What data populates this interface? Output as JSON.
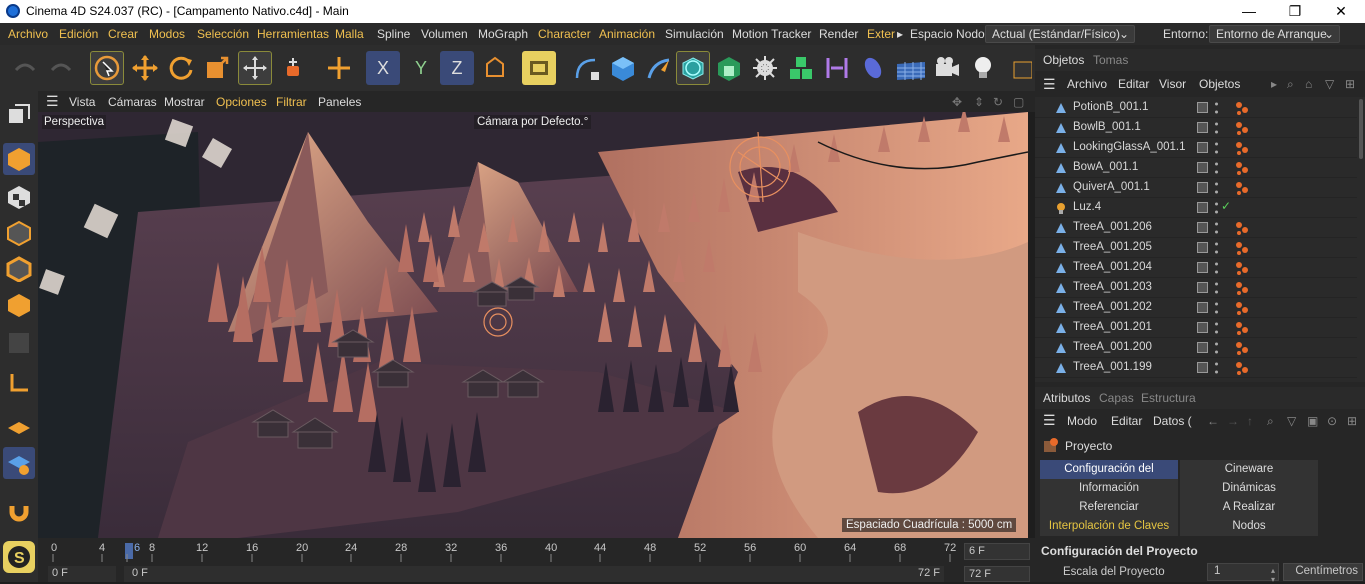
{
  "window": {
    "title": "Cinema 4D S24.037 (RC) - [Campamento Nativo.c4d] - Main",
    "controls": [
      "—",
      "❐",
      "✕"
    ]
  },
  "menubar": {
    "items": [
      "Archivo",
      "Edición",
      "Crear",
      "Modos",
      "Selección",
      "Herramientas",
      "Malla",
      "Spline",
      "Volumen",
      "MoGraph",
      "Character",
      "Animación",
      "Simulación",
      "Motion Tracker",
      "Render",
      "Exter"
    ],
    "node_space_label": "Espacio Nodo:",
    "node_space_value": "Actual (Estándar/Físico)",
    "env_label": "Entorno:",
    "env_value": "Entorno de Arranque"
  },
  "viewport": {
    "menu": [
      "Vista",
      "Cámaras",
      "Mostrar",
      "Opciones",
      "Filtrar",
      "Paneles"
    ],
    "view_name": "Perspectiva",
    "camera_name": "Cámara por Defecto",
    "camera_mark": ".°",
    "grid_spacing": "Espaciado Cuadrícula : 5000 cm"
  },
  "objects_panel": {
    "tabs": [
      "Objetos",
      "Tomas"
    ],
    "menu": [
      "Archivo",
      "Editar",
      "Visor",
      "Objetos"
    ],
    "rows": [
      {
        "name": "PotionB_001.1",
        "type": "mesh"
      },
      {
        "name": "BowlB_001.1",
        "type": "mesh"
      },
      {
        "name": "LookingGlassA_001.1",
        "type": "mesh"
      },
      {
        "name": "BowA_001.1",
        "type": "mesh"
      },
      {
        "name": "QuiverA_001.1",
        "type": "mesh"
      },
      {
        "name": "Luz.4",
        "type": "light"
      },
      {
        "name": "TreeA_001.206",
        "type": "mesh"
      },
      {
        "name": "TreeA_001.205",
        "type": "mesh"
      },
      {
        "name": "TreeA_001.204",
        "type": "mesh"
      },
      {
        "name": "TreeA_001.203",
        "type": "mesh"
      },
      {
        "name": "TreeA_001.202",
        "type": "mesh"
      },
      {
        "name": "TreeA_001.201",
        "type": "mesh"
      },
      {
        "name": "TreeA_001.200",
        "type": "mesh"
      },
      {
        "name": "TreeA_001.199",
        "type": "mesh"
      }
    ]
  },
  "attributes_panel": {
    "tabs": [
      "Atributos",
      "Capas",
      "Estructura"
    ],
    "menu": [
      "Modo",
      "Editar",
      "Datos ("
    ],
    "object_label": "Proyecto",
    "cells": [
      {
        "label": "Configuración del Proyecto",
        "state": "active"
      },
      {
        "label": "Cineware",
        "state": "normal"
      },
      {
        "label": "Información",
        "state": "normal"
      },
      {
        "label": "Dinámicas",
        "state": "normal"
      },
      {
        "label": "Referenciar",
        "state": "normal"
      },
      {
        "label": "A Realizar",
        "state": "normal"
      },
      {
        "label": "Interpolación de Claves",
        "state": "highlight"
      },
      {
        "label": "Nodos",
        "state": "normal"
      }
    ],
    "section_title": "Configuración del Proyecto",
    "scale_label": "Escala del Proyecto",
    "scale_value": "1",
    "scale_unit": "Centímetros"
  },
  "timeline": {
    "ticks": [
      "0",
      "4",
      "6",
      "8",
      "12",
      "16",
      "20",
      "24",
      "28",
      "32",
      "36",
      "40",
      "44",
      "48",
      "52",
      "56",
      "60",
      "64",
      "68",
      "72"
    ],
    "current_frame": "6 F",
    "start_field": "0 F",
    "start_field2": "0 F",
    "end_field": "72 F",
    "end_field2": "72 F"
  },
  "colors": {
    "accent_yellow": "#e5c542",
    "selection_blue": "#3a4a78",
    "terrain": "#c98a70"
  }
}
